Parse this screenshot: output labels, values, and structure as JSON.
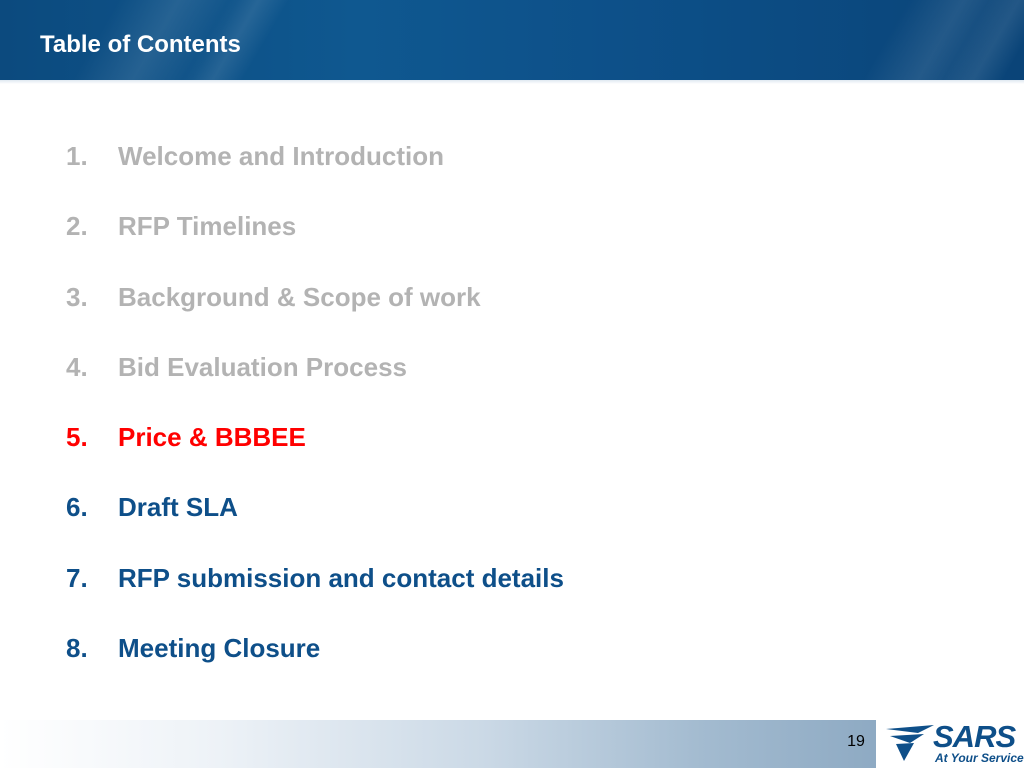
{
  "slide": {
    "title": "Table of Contents",
    "page_number": "19"
  },
  "toc": {
    "items": [
      {
        "num": "1.",
        "label": "Welcome and Introduction",
        "state": "past"
      },
      {
        "num": "2.",
        "label": "RFP Timelines",
        "state": "past"
      },
      {
        "num": "3.",
        "label": "Background & Scope of work",
        "state": "past"
      },
      {
        "num": "4.",
        "label": "Bid Evaluation Process",
        "state": "past"
      },
      {
        "num": "5.",
        "label": "Price & BBBEE",
        "state": "current"
      },
      {
        "num": "6.",
        "label": "Draft SLA",
        "state": "upcoming"
      },
      {
        "num": "7.",
        "label": "RFP submission and contact details",
        "state": "upcoming"
      },
      {
        "num": "8.",
        "label": "Meeting Closure",
        "state": "upcoming"
      }
    ]
  },
  "logo": {
    "name": "SARS",
    "tagline": "At Your Service",
    "icon": "sars-swoosh-icon"
  },
  "colors": {
    "header": "#0f5890",
    "past_item": "#b3b3b3",
    "current_item": "#ff0000",
    "upcoming_item": "#0e4f89"
  }
}
